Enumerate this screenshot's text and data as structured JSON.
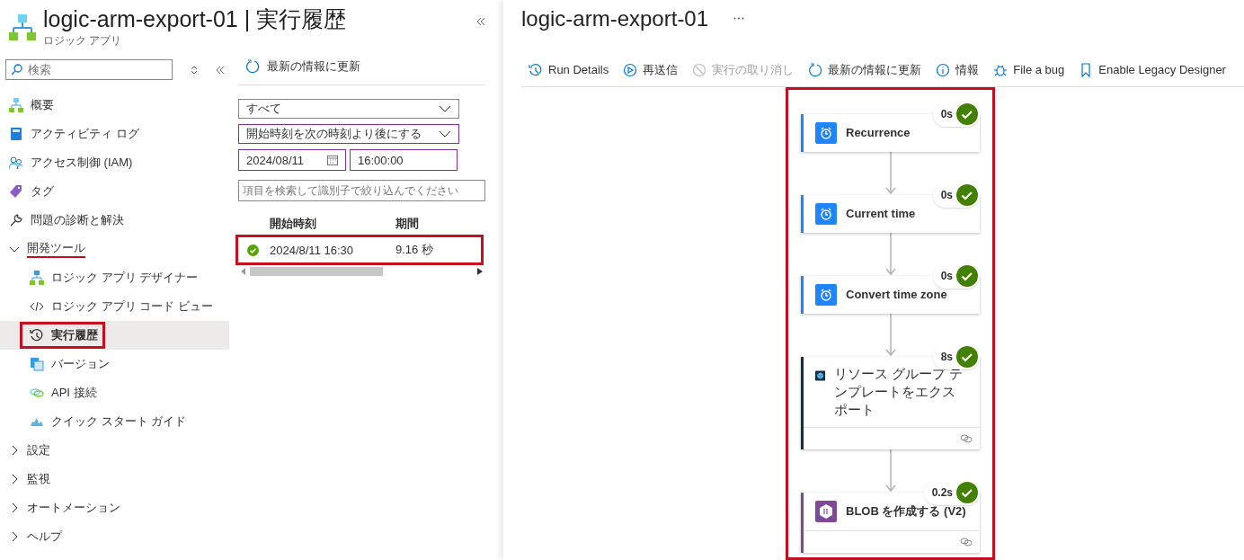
{
  "header": {
    "title": "logic-arm-export-01 | 実行履歴",
    "subtitle": "ロジック アプリ"
  },
  "sidebar": {
    "search": {
      "placeholder": "検索"
    },
    "items": [
      {
        "kind": "link",
        "label": "概要",
        "selected": false
      },
      {
        "kind": "link",
        "label": "アクティビティ ログ",
        "selected": false
      },
      {
        "kind": "link",
        "label": "アクセス制御 (IAM)",
        "selected": false
      },
      {
        "kind": "link",
        "label": "タグ",
        "selected": false
      },
      {
        "kind": "link",
        "label": "問題の診断と解決",
        "selected": false
      },
      {
        "kind": "group",
        "label": "開発ツール",
        "expanded": true,
        "underlined": true,
        "children": [
          {
            "kind": "link",
            "label": "ロジック アプリ デザイナー",
            "selected": false
          },
          {
            "kind": "link",
            "label": "ロジック アプリ コード ビュー",
            "selected": false
          },
          {
            "kind": "link",
            "label": "実行履歴",
            "selected": true,
            "highlighted": true
          },
          {
            "kind": "link",
            "label": "バージョン",
            "selected": false
          },
          {
            "kind": "link",
            "label": "API 接続",
            "selected": false
          },
          {
            "kind": "link",
            "label": "クイック スタート ガイド",
            "selected": false
          }
        ]
      },
      {
        "kind": "group",
        "label": "設定",
        "expanded": false,
        "underlined": false
      },
      {
        "kind": "group",
        "label": "監視",
        "expanded": false,
        "underlined": false
      },
      {
        "kind": "group",
        "label": "オートメーション",
        "expanded": false,
        "underlined": false
      },
      {
        "kind": "group",
        "label": "ヘルプ",
        "expanded": false,
        "underlined": false
      }
    ]
  },
  "runs": {
    "refresh": "最新の情報に更新",
    "status_filter": "すべて",
    "time_filter": "開始時刻を次の時刻より後にする",
    "date": "2024/08/11",
    "time": "16:00:00",
    "search": {
      "placeholder": "項目を検索して識別子で絞り込んでください"
    },
    "columns": [
      "開始時刻",
      "期間"
    ],
    "rows": [
      {
        "succeeded": true,
        "start": "2024/8/11 16:30",
        "duration": "9.16 秒",
        "highlighted": true
      }
    ]
  },
  "designer": {
    "title": "logic-arm-export-01",
    "toolbar": [
      {
        "label": "Run Details",
        "disabled": false
      },
      {
        "label": "再送信",
        "disabled": false
      },
      {
        "label": "実行の取り消し",
        "disabled": true
      },
      {
        "label": "最新の情報に更新",
        "disabled": false
      },
      {
        "label": "情報",
        "disabled": false
      },
      {
        "label": "File a bug",
        "disabled": false
      },
      {
        "label": "Enable Legacy Designer",
        "disabled": false
      }
    ],
    "highlighted": true,
    "steps": [
      {
        "kind": "schedule",
        "title": "Recurrence",
        "duration": "0s",
        "succeeded": true,
        "color": "#1f85ff",
        "connection": false
      },
      {
        "kind": "schedule",
        "title": "Current time",
        "duration": "0s",
        "succeeded": true,
        "color": "#1f85ff",
        "connection": false
      },
      {
        "kind": "schedule",
        "title": "Convert time zone",
        "duration": "0s",
        "succeeded": true,
        "color": "#1f85ff",
        "connection": false
      },
      {
        "kind": "arm",
        "title": "リソース グループ テンプレートをエクスポート",
        "duration": "8s",
        "succeeded": true,
        "color": "#0e2f4e",
        "connection": true
      },
      {
        "kind": "blob",
        "title": "BLOB を作成する (V2)",
        "duration": "0.2s",
        "succeeded": true,
        "color": "#804998",
        "connection": true
      }
    ]
  }
}
